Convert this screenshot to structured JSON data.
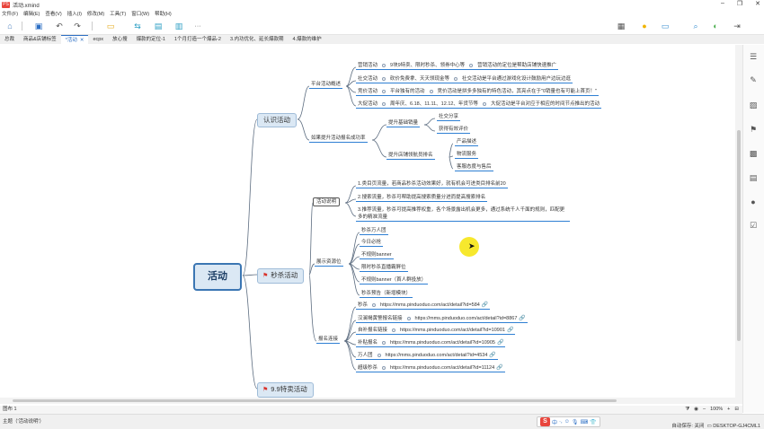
{
  "window": {
    "app_badge": "PS",
    "title": "活动.xmind"
  },
  "window_controls": {
    "minimize": "–",
    "restore": "❐",
    "close": "✕"
  },
  "menu": [
    "文件(F)",
    "编辑(E)",
    "查看(V)",
    "插入(I)",
    "修改(M)",
    "工具(T)",
    "窗口(W)",
    "帮助(H)"
  ],
  "toolbar": {
    "more": "···"
  },
  "tabs": [
    {
      "label": "总裁"
    },
    {
      "label": "商品&店铺标签"
    },
    {
      "label": "*活动",
      "close": "✕"
    },
    {
      "label": "ecpx"
    },
    {
      "label": "放心搜"
    },
    {
      "label": "爆款的定位-1"
    },
    {
      "label": "1个月打造一个爆品-2"
    },
    {
      "label": "3.内功优化、延长爆款期"
    },
    {
      "label": "4.爆款的维护"
    }
  ],
  "mindmap": {
    "root": "活动",
    "branch1": {
      "label": "认识活动",
      "platform": {
        "label": "平台活动概述",
        "rows": [
          {
            "a": "营销活动",
            "b": "9块9特卖、限时秒杀、领券中心等",
            "c": "营销活动的定位是帮助店铺快速推广"
          },
          {
            "a": "社交活动",
            "b": "砍价免费拿、天天领现金等",
            "c": "社交活动是平台通过游戏化设计鼓励用户边玩边逛"
          },
          {
            "a": "竞价活动",
            "b": "平台独有的活动",
            "c": "竞价活动是拼多多独有的特色活动，其亮点在于\"0销量也有可能上首页！\""
          },
          {
            "a": "大促活动",
            "b": "周年庆、6.18、11.11、12.12、年货节等",
            "c": "大促活动是平台对应于相应的时间节点推出的活动"
          }
        ]
      },
      "improve": {
        "label": "如果提升活动报名成功率",
        "base": {
          "label": "提升基础销量",
          "items": [
            "社交分享",
            "获得有效评价"
          ]
        },
        "shop": {
          "label": "提升店铺领航员排名",
          "items": [
            "产品描述",
            "物流服务",
            "客服态度与售后"
          ]
        }
      }
    },
    "branch2": {
      "label": "秒杀活动",
      "desc": {
        "label": "活动说明",
        "items": [
          "1.类目页流量，若商品秒杀活动效果好，就有机会可进类目排名前20",
          "2.搜索流量，秒杀可帮助提高搜索质量分进而提高搜索排名",
          "3.推荐流量，秒杀可提高推荐权重，各个场景露出机会更多，通过系统千人千面的规则，匹配更多的精准流量"
        ]
      },
      "positions": {
        "label": "展示资源位",
        "items": [
          "秒杀万人团",
          "今日必抢",
          "不规则banner",
          "限时秒杀直播霸屏位",
          "不规则banner（首人群投放）",
          "秒杀预告（新增模块）"
        ]
      },
      "signup": {
        "label": "报名连接",
        "items": [
          {
            "name": "秒杀",
            "url": "https://mms.pinduoduo.com/act/detail?id=584"
          },
          {
            "name": "汉澜褐黄警报名链接",
            "url": "https://mms.pinduoduo.com/act/detail?id=8867"
          },
          {
            "name": "自补报名链接",
            "url": "https://mms.pinduoduo.com/act/detail?id=10901"
          },
          {
            "name": "补贴报名",
            "url": "https://mms.pinduoduo.com/act/detail?id=10905"
          },
          {
            "name": "万人团",
            "url": "https://mms.pinduoduo.com/act/detail?id=4534"
          },
          {
            "name": "超级秒杀",
            "url": "https://mms.pinduoduo.com/act/detail?id=11124"
          }
        ]
      }
    },
    "branch3": {
      "label": "9.9特卖活动"
    }
  },
  "statusbar": {
    "sheet": "图布 1",
    "zoom": "100%",
    "zoom_minus": "–",
    "zoom_plus": "+"
  },
  "bottombar": {
    "topic": "主题（'活动说明'）",
    "autosave": "自动保存: 关闭",
    "computer": "DESKTOP-GJ4CML1"
  },
  "ime": {
    "badge": "S",
    "items": [
      "中",
      "·,",
      "☺",
      "🎙",
      "⌨",
      "👕"
    ]
  },
  "accent": "#2e7fd3",
  "flag_color": "#d9322b",
  "highlight_color": "#f6e616"
}
